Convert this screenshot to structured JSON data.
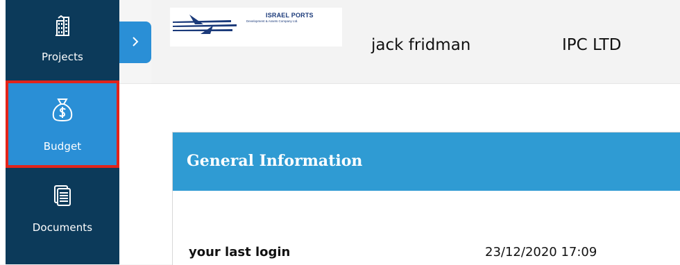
{
  "sidebar": {
    "items": [
      {
        "label": "Projects",
        "icon": "building-icon"
      },
      {
        "label": "Budget",
        "icon": "money-bag-icon",
        "active": true
      },
      {
        "label": "Documents",
        "icon": "documents-icon"
      }
    ]
  },
  "header": {
    "logo": {
      "title": "ISRAEL PORTS",
      "subtitle": "Development & Assets Company Ltd."
    },
    "user_name": "jack fridman",
    "company": "IPC LTD"
  },
  "toggle": {
    "icon": "chevron-right-icon"
  },
  "general_info": {
    "title": "General Information",
    "last_login_label": "your last login",
    "last_login_value": "23/12/2020 17:09"
  },
  "colors": {
    "sidebar": "#0c3a5a",
    "accent": "#2a8fd6",
    "card_header": "#2f9bd3",
    "highlight_border": "#e2231a"
  }
}
